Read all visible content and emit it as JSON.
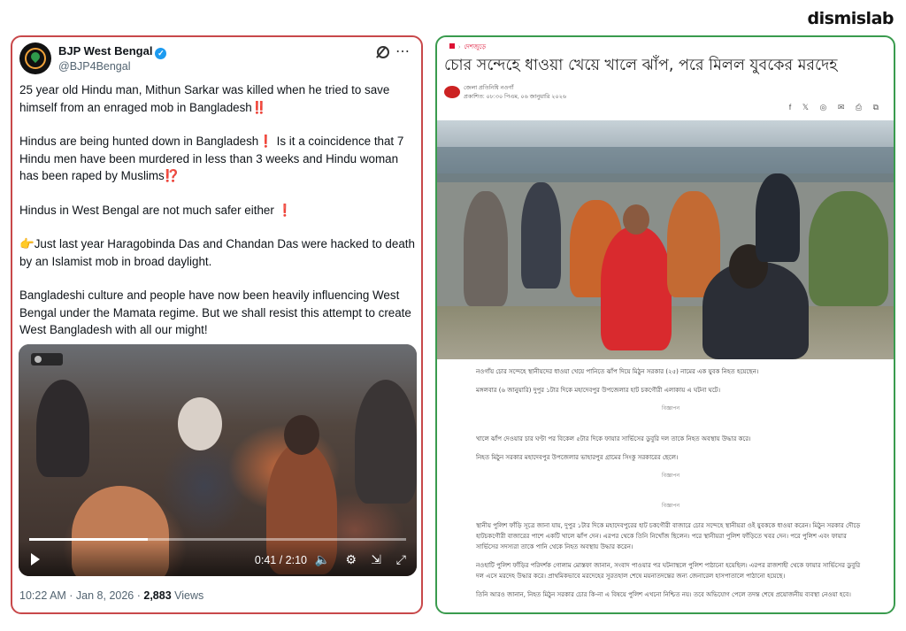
{
  "brand": "dismislab",
  "tweet": {
    "name": "BJP West Bengal",
    "handle": "@BJP4Bengal",
    "paragraphs": [
      {
        "text": "25 year old Hindu man, Mithun Sarkar was killed when he tried to save himself from an enraged mob in Bangladesh",
        "emoji": "‼️"
      },
      {
        "text": "Hindus are being hunted down in Bangladesh",
        "emoji": "❗",
        "text2": " Is it a coincidence that 7 Hindu men have been murdered in less than 3 weeks and Hindu woman has been raped by Muslims",
        "emoji2": "⁉️"
      },
      {
        "text": "Hindus in West Bengal are not much safer either",
        "emoji": "❗"
      },
      {
        "lead": "👉",
        "text": "Just last year Haragobinda Das and Chandan Das were hacked to death by an Islamist mob in broad daylight."
      },
      {
        "text": "Bangladeshi culture and people have now been heavily influencing West Bengal under the Mamata regime. But we shall resist this attempt to create West Bangladesh with all our might!"
      }
    ],
    "video": {
      "time": "0:41 / 2:10",
      "progress": 0.315
    },
    "date": "10:22 AM · Jan 8, 2026 · ",
    "views": "2,883",
    "views_label": " Views"
  },
  "article": {
    "crumb": "দেশজুড়ে",
    "title": "চোর সন্দেহে ধাওয়া খেয়ে খালে ঝাঁপ, পরে মিলল যুবকের মরদেহ",
    "author": "জেলা প্রতিনিধি নওগাঁ",
    "published": "প্রকাশিত: ০৮:৩০ পিএম, ০৬ জানুয়ারি ২০২৬",
    "share_icons": "f 𝕏 ◎ ✉ ⎙ ⧉",
    "paragraphs": [
      "নওগাঁয় চোর সন্দেহে স্থানীয়দের ধাওয়া খেয়ে পানিতে ঝাঁপ দিয়ে মিঠুন সরকার (২৫) নামের এক যুবক নিহত হয়েছেন।",
      "মঙ্গলবার (৬ জানুয়ারি) দুপুর ১টার দিকে মহাদেবপুর উপজেলার হাট চকগৌরী এলাকায় এ ঘটনা ঘটে।",
      "খালে ঝাঁপ দেওয়ার চার ঘণ্টা পর বিকেল ৫টার দিকে ফায়ার সার্ভিসের ডুবুরি দল তাকে নিহত অবস্থায় উদ্ধার করে।",
      "নিহত মিঠুন সরকার মহাদেবপুর উপজেলার ভাহারপুর গ্রামের সিংকু সরকারের ছেলে।",
      "স্থানীয় পুলিশ ফাঁড়ি সূত্রে জানা যায়, দুপুর ১টার দিকে মহাদেবপুরের হাট চকগৌরী বাজারে চোর সন্দেহে স্থানীয়রা ওই যুবককে ধাওয়া করেন। মিঠুন সরকার দৌড়ে হাটচকগৌরী বাজারের পাশে একটি খালে ঝাঁপ দেন। এরপর থেকে তিনি নিখোঁজ ছিলেন। পরে স্থানীয়রা পুলিশ ফাঁড়িতে খবর দেন। পরে পুলিশ এবং ফায়ার সার্ভিসের সদস্যরা তাকে পানি থেকে নিহত অবস্থায় উদ্ধার করেন।",
      "নওহাটি পুলিশ ফাঁড়ির পরিদর্শক গোলাম মোস্তফা জানান, সংবাদ পাওয়ার পর ঘটনাস্থলে পুলিশ পাঠানো হয়েছিল। এরপর রাজশাহী থেকে ফায়ার সার্ভিসের ডুবুরি দল এসে মরদেহ উদ্ধার করে। প্রাথমিকভাবে মরদেহের সুরতহাল শেষে ময়নাতদন্তের জন্য জেনারেল হাসপাতালে পাঠানো হয়েছে।",
      "তিনি আরও জানান, নিহত মিঠুন সরকার চোর কি-না এ বিষয়ে পুলিশ এখনো নিশ্চিত নয়। তবে অভিযোগ পেলে তদন্ত শেষে প্রয়োজনীয় ব্যবস্থা নেওয়া হবে।"
    ],
    "ad_label": "বিজ্ঞাপন"
  },
  "colors": {
    "tweet_border": "#c8484a",
    "article_border": "#3a9b4e",
    "accent_red": "#e0262c",
    "verified_blue": "#1d9bf0"
  },
  "icons": [
    "verified-badge-icon",
    "grok-icon",
    "more-icon",
    "play-icon",
    "volume-icon",
    "settings-icon",
    "minimize-icon",
    "fullscreen-icon",
    "home-icon",
    "facebook-icon",
    "x-icon",
    "whatsapp-icon",
    "mail-icon",
    "print-icon",
    "copy-icon"
  ]
}
